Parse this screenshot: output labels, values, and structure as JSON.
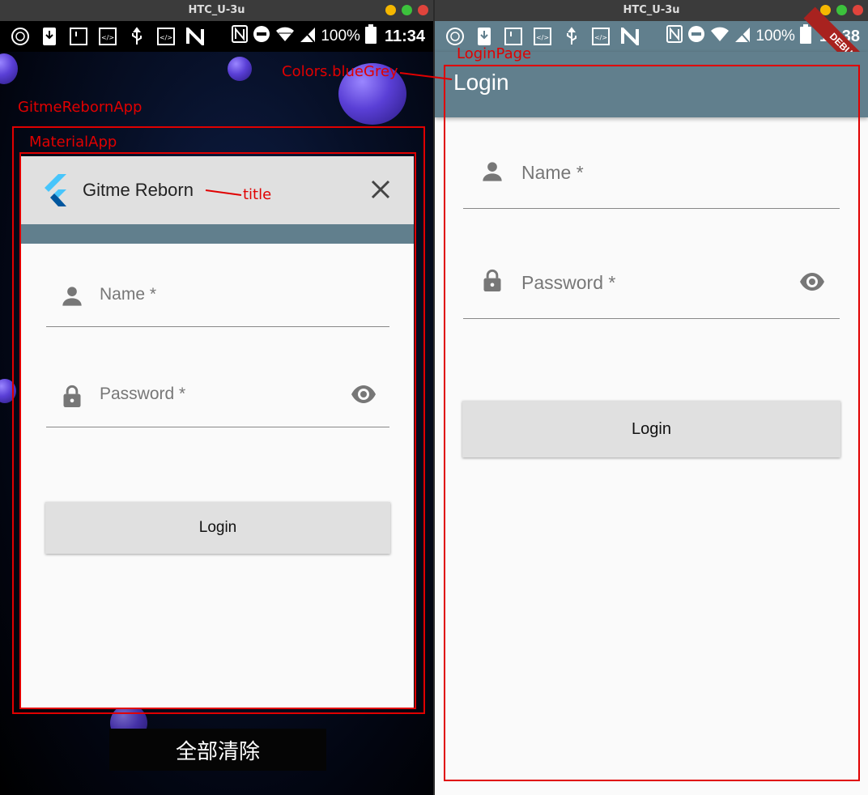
{
  "left": {
    "window_title": "HTC_U-3u",
    "status": {
      "battery": "100%",
      "time": "11:34"
    },
    "annotations": {
      "app": "GitmeRebornApp",
      "material": "MaterialApp",
      "title_note": "title",
      "color_note": "Colors.blueGrey"
    },
    "card": {
      "title": "Gitme Reborn",
      "name_label": "Name *",
      "password_label": "Password *",
      "login_label": "Login"
    },
    "clear_all": "全部清除"
  },
  "right": {
    "window_title": "HTC_U-3u",
    "status": {
      "battery": "100%",
      "time": "11:38"
    },
    "annotations": {
      "page": "LoginPage"
    },
    "appbar_title": "Login",
    "debug_banner": "DEBUG",
    "name_label": "Name *",
    "password_label": "Password *",
    "login_label": "Login"
  },
  "colors": {
    "accent_bluegrey": "#617f8d",
    "annotation_red": "#e00000",
    "button_grey": "#e0e0e0"
  },
  "icons": {
    "window_dots": [
      "minimize-yellow",
      "maximize-green",
      "close-red"
    ],
    "status_left": [
      "app-icon",
      "download-icon",
      "sim-icon",
      "code-icon",
      "usb-icon",
      "code-icon",
      "n-icon"
    ],
    "status_right": [
      "nfc-icon",
      "dnd-icon",
      "wifi-icon",
      "no-signal-icon",
      "battery-icon"
    ]
  }
}
